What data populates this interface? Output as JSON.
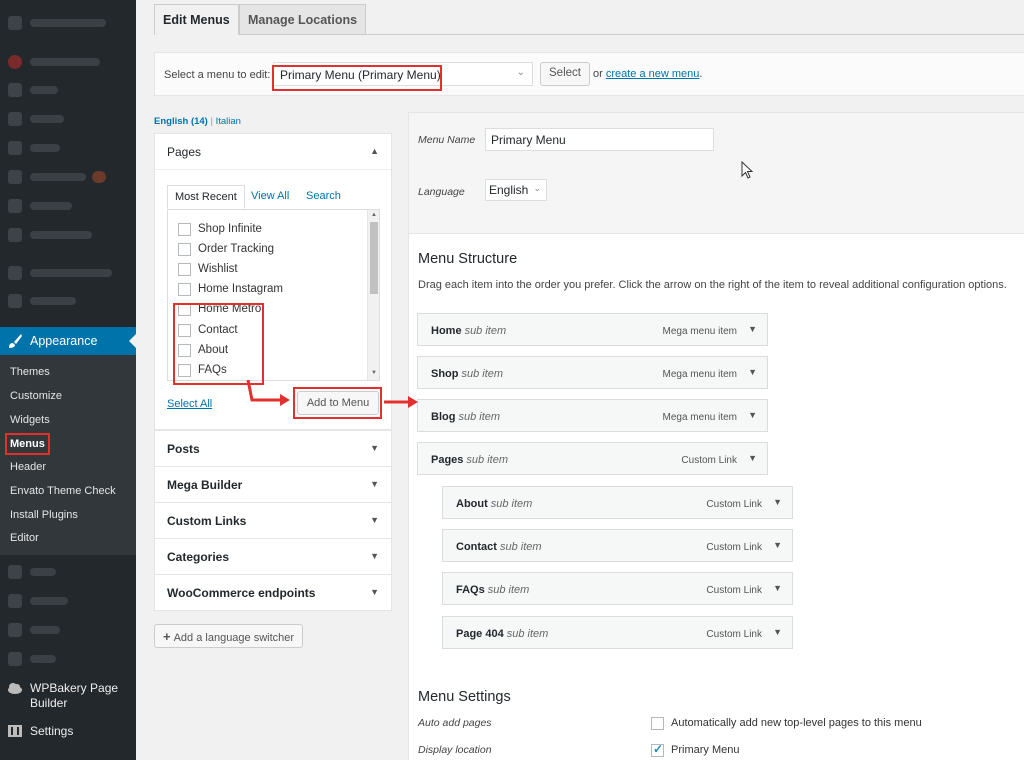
{
  "tabs": {
    "edit": "Edit Menus",
    "manage": "Manage Locations"
  },
  "select_bar": {
    "label": "Select a menu to edit:",
    "selected": "Primary Menu (Primary Menu)",
    "select_button": "Select",
    "or_text": "or",
    "create_link": "create a new menu",
    "period": "."
  },
  "languages": {
    "english": "English (14)",
    "separator": "|",
    "italian": "Italian"
  },
  "sidebar": {
    "appearance": "Appearance",
    "submenu": [
      "Themes",
      "Customize",
      "Widgets",
      "Menus",
      "Header",
      "Envato Theme Check",
      "Install Plugins",
      "Editor"
    ],
    "wpbakery": "WPBakery Page Builder",
    "settings": "Settings"
  },
  "pages_box": {
    "title": "Pages",
    "tabs": {
      "recent": "Most Recent",
      "all": "View All",
      "search": "Search"
    },
    "items": [
      "Shop Infinite",
      "Order Tracking",
      "Wishlist",
      "Home Instagram",
      "Home Metro",
      "Contact",
      "About",
      "FAQs"
    ],
    "select_all": "Select All",
    "add_button": "Add to Menu"
  },
  "accordions": [
    "Posts",
    "Mega Builder",
    "Custom Links",
    "Categories",
    "WooCommerce endpoints"
  ],
  "lang_switcher": "Add a language switcher",
  "menu_header": {
    "name_label": "Menu Name",
    "name_value": "Primary Menu",
    "language_label": "Language",
    "language_value": "English"
  },
  "structure": {
    "title": "Menu Structure",
    "description": "Drag each item into the order you prefer. Click the arrow on the right of the item to reveal additional configuration options.",
    "sub_label": "sub item",
    "items": [
      {
        "title": "Home",
        "type": "Mega menu item"
      },
      {
        "title": "Shop",
        "type": "Mega menu item"
      },
      {
        "title": "Blog",
        "type": "Mega menu item"
      },
      {
        "title": "Pages",
        "type": "Custom Link"
      },
      {
        "title": "About",
        "type": "Custom Link"
      },
      {
        "title": "Contact",
        "type": "Custom Link"
      },
      {
        "title": "FAQs",
        "type": "Custom Link"
      },
      {
        "title": "Page 404",
        "type": "Custom Link"
      }
    ]
  },
  "settings": {
    "title": "Menu Settings",
    "auto_add_label": "Auto add pages",
    "auto_add_text": "Automatically add new top-level pages to this menu",
    "auto_add_checked": false,
    "display_label": "Display location",
    "display_text": "Primary Menu",
    "display_checked": true
  },
  "colors": {
    "accent": "#0073aa",
    "annotation": "#e2302f",
    "sidebar_bg": "#23282d"
  }
}
